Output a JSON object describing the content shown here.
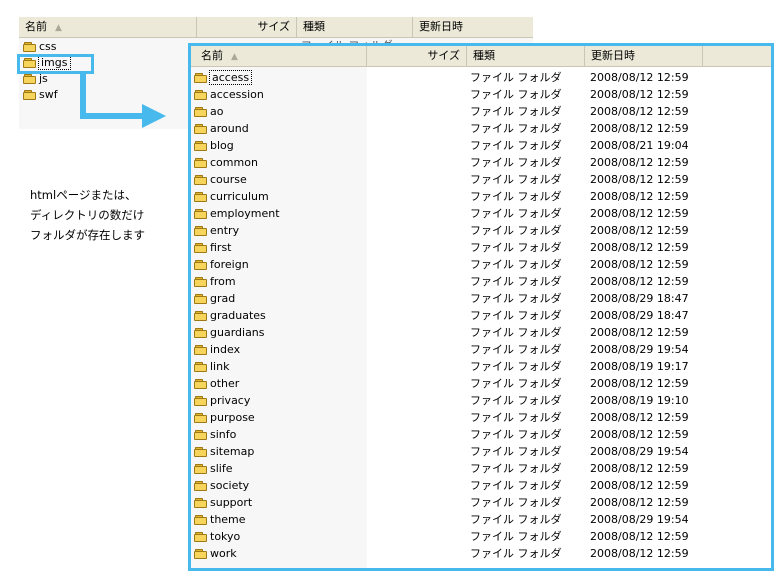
{
  "back_window": {
    "columns": {
      "name": "名前",
      "size": "サイズ",
      "type": "種類",
      "date": "更新日時"
    },
    "partial_row_text": "ファイル フォルダ",
    "items": [
      "css",
      "imgs",
      "js",
      "swf"
    ]
  },
  "front_window": {
    "columns": {
      "name": "名前",
      "size": "サイズ",
      "type": "種類",
      "date": "更新日時"
    },
    "rows": [
      {
        "name": "access",
        "type": "ファイル フォルダ",
        "date": "2008/08/12 12:59"
      },
      {
        "name": "accession",
        "type": "ファイル フォルダ",
        "date": "2008/08/12 12:59"
      },
      {
        "name": "ao",
        "type": "ファイル フォルダ",
        "date": "2008/08/12 12:59"
      },
      {
        "name": "around",
        "type": "ファイル フォルダ",
        "date": "2008/08/12 12:59"
      },
      {
        "name": "blog",
        "type": "ファイル フォルダ",
        "date": "2008/08/21 19:04"
      },
      {
        "name": "common",
        "type": "ファイル フォルダ",
        "date": "2008/08/12 12:59"
      },
      {
        "name": "course",
        "type": "ファイル フォルダ",
        "date": "2008/08/12 12:59"
      },
      {
        "name": "curriculum",
        "type": "ファイル フォルダ",
        "date": "2008/08/12 12:59"
      },
      {
        "name": "employment",
        "type": "ファイル フォルダ",
        "date": "2008/08/12 12:59"
      },
      {
        "name": "entry",
        "type": "ファイル フォルダ",
        "date": "2008/08/12 12:59"
      },
      {
        "name": "first",
        "type": "ファイル フォルダ",
        "date": "2008/08/12 12:59"
      },
      {
        "name": "foreign",
        "type": "ファイル フォルダ",
        "date": "2008/08/12 12:59"
      },
      {
        "name": "from",
        "type": "ファイル フォルダ",
        "date": "2008/08/12 12:59"
      },
      {
        "name": "grad",
        "type": "ファイル フォルダ",
        "date": "2008/08/29 18:47"
      },
      {
        "name": "graduates",
        "type": "ファイル フォルダ",
        "date": "2008/08/29 18:47"
      },
      {
        "name": "guardians",
        "type": "ファイル フォルダ",
        "date": "2008/08/12 12:59"
      },
      {
        "name": "index",
        "type": "ファイル フォルダ",
        "date": "2008/08/29 19:54"
      },
      {
        "name": "link",
        "type": "ファイル フォルダ",
        "date": "2008/08/19 19:17"
      },
      {
        "name": "other",
        "type": "ファイル フォルダ",
        "date": "2008/08/12 12:59"
      },
      {
        "name": "privacy",
        "type": "ファイル フォルダ",
        "date": "2008/08/19 19:10"
      },
      {
        "name": "purpose",
        "type": "ファイル フォルダ",
        "date": "2008/08/12 12:59"
      },
      {
        "name": "sinfo",
        "type": "ファイル フォルダ",
        "date": "2008/08/12 12:59"
      },
      {
        "name": "sitemap",
        "type": "ファイル フォルダ",
        "date": "2008/08/29 19:54"
      },
      {
        "name": "slife",
        "type": "ファイル フォルダ",
        "date": "2008/08/12 12:59"
      },
      {
        "name": "society",
        "type": "ファイル フォルダ",
        "date": "2008/08/12 12:59"
      },
      {
        "name": "support",
        "type": "ファイル フォルダ",
        "date": "2008/08/12 12:59"
      },
      {
        "name": "theme",
        "type": "ファイル フォルダ",
        "date": "2008/08/29 19:54"
      },
      {
        "name": "tokyo",
        "type": "ファイル フォルダ",
        "date": "2008/08/12 12:59"
      },
      {
        "name": "work",
        "type": "ファイル フォルダ",
        "date": "2008/08/12 12:59"
      }
    ]
  },
  "annotation": {
    "lines": [
      "htmlページまたは、",
      "ディレクトリの数だけ",
      "フォルダが存在します"
    ]
  },
  "colors": {
    "highlight": "#47b9ec",
    "header": "#ece9d8",
    "folder": "#f7d45c"
  }
}
